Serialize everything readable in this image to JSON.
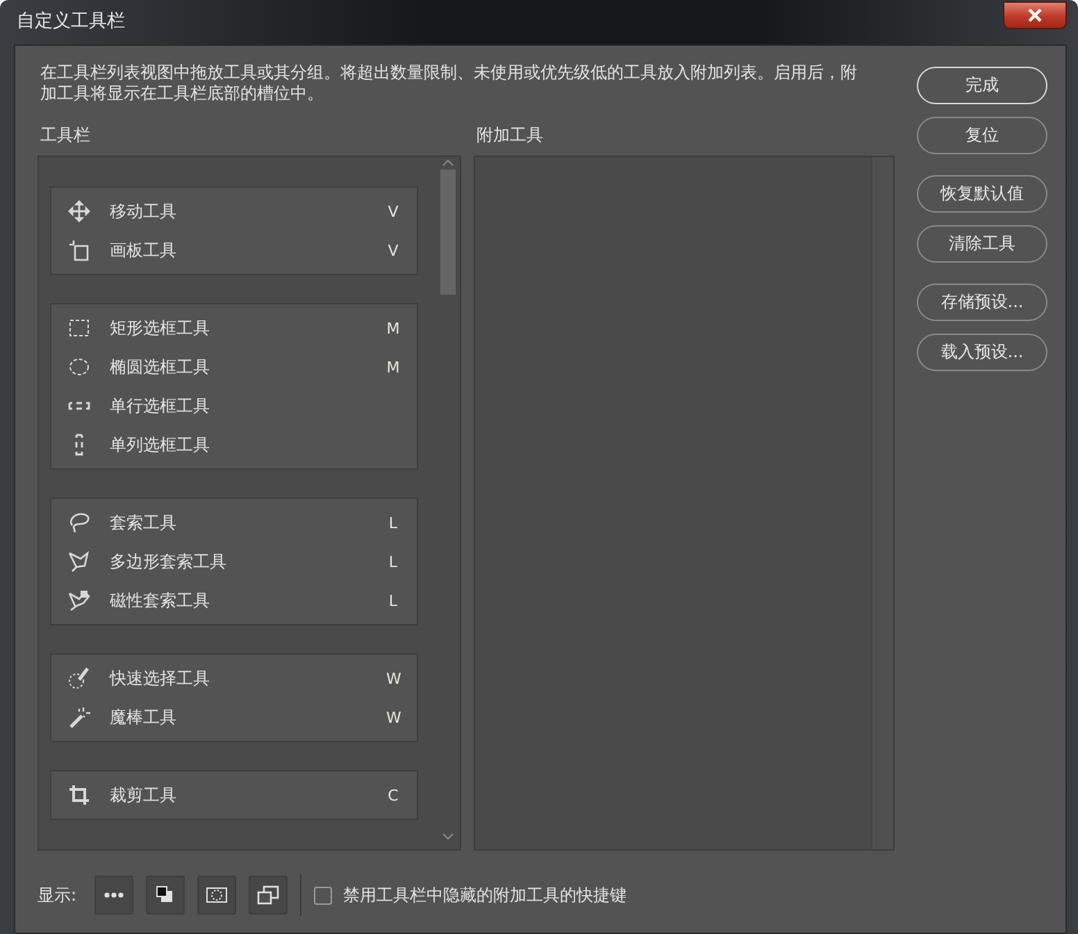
{
  "window": {
    "title": "自定义工具栏"
  },
  "description": "在工具栏列表视图中拖放工具或其分组。将超出数量限制、未使用或优先级低的工具放入附加列表。启用后，附加工具将显示在工具栏底部的槽位中。",
  "toolbar": {
    "label": "工具栏",
    "groups": [
      {
        "tools": [
          {
            "name": "移动工具",
            "shortcut": "V"
          },
          {
            "name": "画板工具",
            "shortcut": "V"
          }
        ]
      },
      {
        "tools": [
          {
            "name": "矩形选框工具",
            "shortcut": "M"
          },
          {
            "name": "椭圆选框工具",
            "shortcut": "M"
          },
          {
            "name": "单行选框工具"
          },
          {
            "name": "单列选框工具"
          }
        ]
      },
      {
        "tools": [
          {
            "name": "套索工具",
            "shortcut": "L"
          },
          {
            "name": "多边形套索工具",
            "shortcut": "L"
          },
          {
            "name": "磁性套索工具",
            "shortcut": "L"
          }
        ]
      },
      {
        "tools": [
          {
            "name": "快速选择工具",
            "shortcut": "W"
          },
          {
            "name": "魔棒工具",
            "shortcut": "W"
          }
        ]
      },
      {
        "tools": [
          {
            "name": "裁剪工具",
            "shortcut": "C"
          }
        ]
      }
    ]
  },
  "extra_tools": {
    "label": "附加工具"
  },
  "buttons": [
    {
      "label": "完成",
      "default": true
    },
    {
      "label": "复位",
      "default": false
    },
    {
      "label": "恢复默认值",
      "default": false
    },
    {
      "label": "清除工具",
      "default": false
    },
    {
      "label": "存储预设...",
      "default": false
    },
    {
      "label": "载入预设...",
      "default": false
    }
  ],
  "footer": {
    "show_label": "显示:",
    "checkbox": {
      "label": "禁用工具栏中隐藏的附加工具的快捷键",
      "checked": false
    }
  }
}
